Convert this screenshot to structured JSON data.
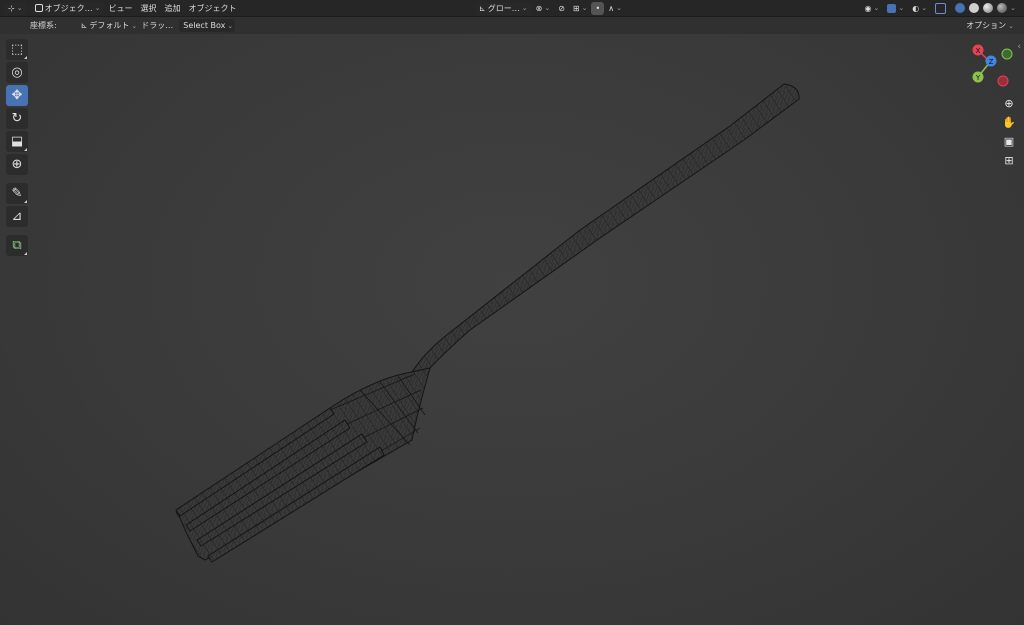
{
  "header": {
    "mode_label": "オブジェク…",
    "menu": [
      "ビュー",
      "選択",
      "追加",
      "オブジェクト"
    ],
    "transform_label": "グロー…"
  },
  "tool_header": {
    "coord_label": "座標系:",
    "coord_value": "デフォルト",
    "drag_label": "ドラッ…",
    "drag_value": "Select Box",
    "options_label": "オプション"
  },
  "gizmo": {
    "x": "X",
    "y": "Y",
    "z": "Z"
  },
  "toolbar": {
    "active_tool": "move",
    "tools": [
      "select-box",
      "cursor",
      "move",
      "rotate",
      "scale",
      "transform",
      "annotate",
      "measure",
      "add-cube"
    ]
  },
  "colors": {
    "accent": "#4772b3",
    "axis_x": "#e34453",
    "axis_y": "#8bc34a",
    "axis_z": "#3f87e0"
  }
}
